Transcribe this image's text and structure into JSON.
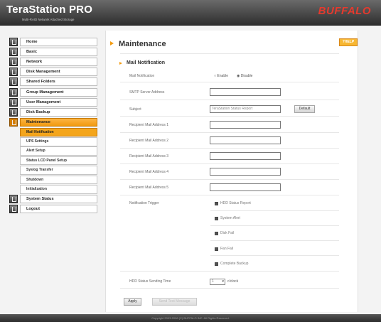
{
  "header": {
    "product": "TeraStation PRO",
    "product_sub": "Multi-RAID Network Attached Storage",
    "brand": "BUFFALO"
  },
  "nav": {
    "items": [
      {
        "label": "Home"
      },
      {
        "label": "Basic"
      },
      {
        "label": "Network"
      },
      {
        "label": "Disk Management"
      },
      {
        "label": "Shared Folders"
      },
      {
        "label": "Group Management"
      },
      {
        "label": "User Management"
      },
      {
        "label": "Disk Backup"
      },
      {
        "label": "Maintenance",
        "active": true
      }
    ],
    "subitems": [
      {
        "label": "Mail Notification",
        "active": true
      },
      {
        "label": "UPS Settings"
      },
      {
        "label": "Alert Setup"
      },
      {
        "label": "Status LCD Panel Setup"
      },
      {
        "label": "Syslog Transfer"
      },
      {
        "label": "Shutdown"
      },
      {
        "label": "Initialization"
      }
    ],
    "bottom_items": [
      {
        "label": "System Status"
      },
      {
        "label": "Logout"
      }
    ]
  },
  "page": {
    "title": "Maintenance",
    "help_label": "?HELP",
    "section_title": "Mail Notification"
  },
  "form": {
    "mail_notification": {
      "label": "Mail Notification",
      "options": [
        "Enable",
        "Disable"
      ],
      "selected": "Disable"
    },
    "smtp": {
      "label": "SMTP Server Address",
      "value": ""
    },
    "subject": {
      "label": "Subject",
      "value": "TeraStation Status Report",
      "default_button": "Default"
    },
    "recipients": [
      {
        "label": "Recipient Mail Address 1",
        "value": ""
      },
      {
        "label": "Recipient Mail Address 2",
        "value": ""
      },
      {
        "label": "Recipient Mail Address 3",
        "value": ""
      },
      {
        "label": "Recipient Mail Address 4",
        "value": ""
      },
      {
        "label": "Recipient Mail Address 5",
        "value": ""
      }
    ],
    "trigger": {
      "label": "Notification Trigger",
      "options": [
        {
          "label": "HDD Status Report",
          "checked": true
        },
        {
          "label": "System Alert",
          "checked": true
        },
        {
          "label": "Disk Fail",
          "checked": true
        },
        {
          "label": "Fan Fail",
          "checked": true
        },
        {
          "label": "Complete Backup",
          "checked": true
        }
      ]
    },
    "sending_time": {
      "label": "HDD Status Sending Time",
      "value": "1",
      "suffix": "o'clock"
    }
  },
  "actions": {
    "apply": "Apply",
    "test": "Send Test Message"
  },
  "footer": "Copyright 2003-2006 (C) BUFFALO INC. All Rights Reserved."
}
